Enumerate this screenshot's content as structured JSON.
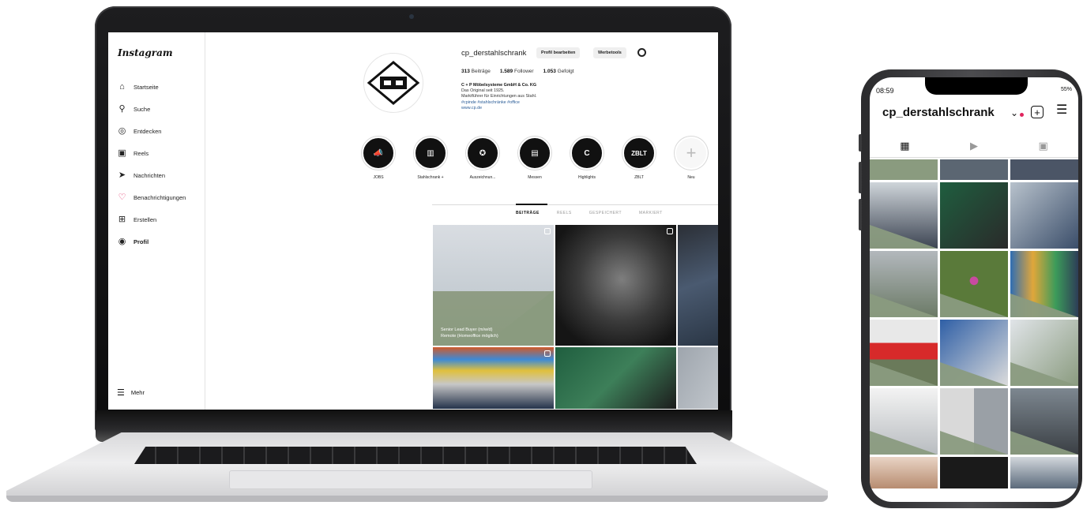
{
  "instagram_desktop": {
    "logo": "Instagram",
    "nav": [
      {
        "label": "Startseite",
        "icon": "home-icon"
      },
      {
        "label": "Suche",
        "icon": "search-icon"
      },
      {
        "label": "Entdecken",
        "icon": "compass-icon"
      },
      {
        "label": "Reels",
        "icon": "reels-icon"
      },
      {
        "label": "Nachrichten",
        "icon": "send-icon"
      },
      {
        "label": "Benachrichtigungen",
        "icon": "heart-icon"
      },
      {
        "label": "Erstellen",
        "icon": "plus-square-icon"
      },
      {
        "label": "Profil",
        "icon": "profile-icon"
      }
    ],
    "more": "Mehr",
    "profile": {
      "username": "cp_derstahlschrank",
      "edit_button": "Profil bearbeiten",
      "ads_button": "Werbetools",
      "posts_count": "313",
      "posts_label": "Beiträge",
      "followers_count": "1.589",
      "followers_label": "Follower",
      "following_count": "1.053",
      "following_label": "Gefolgt",
      "bio_name": "C + P Möbelsysteme GmbH & Co. KG",
      "bio_line1": "Das Original seit 1925.",
      "bio_line2": "Marktführer für Einrichtungen aus Stahl.",
      "bio_tags": "#cpinde #stahlschränke #office",
      "bio_link": "www.cp.de"
    },
    "highlights": [
      {
        "label": "JOBS",
        "glyph": "📣"
      },
      {
        "label": "Stahlschrank +",
        "glyph": "▥"
      },
      {
        "label": "Auszeichnun...",
        "glyph": "✪"
      },
      {
        "label": "Messen",
        "glyph": "▤"
      },
      {
        "label": "Highlights",
        "glyph": "C"
      },
      {
        "label": "ZBLT",
        "glyph": "ZBLT"
      },
      {
        "label": "Neu",
        "glyph": "+"
      }
    ],
    "tabs": [
      {
        "label": "BEITRÄGE",
        "active": true
      },
      {
        "label": "REELS",
        "active": false
      },
      {
        "label": "GESPEICHERT",
        "active": false
      },
      {
        "label": "MARKIERT",
        "active": false
      }
    ],
    "post_caption_line1": "Senior Lead Buyer (m/w/d)",
    "post_caption_line2": "Remote (Homeoffice möglich)"
  },
  "instagram_mobile": {
    "time": "08:59",
    "battery": "55%",
    "username": "cp_derstahlschrank"
  }
}
